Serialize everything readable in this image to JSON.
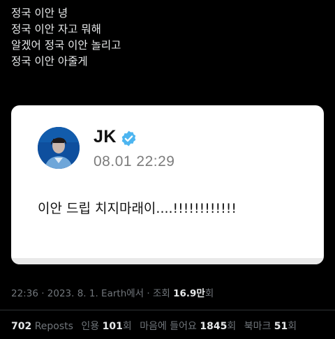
{
  "tweet": {
    "lines": [
      "정국 이안 녕",
      "정국 이안 자고 뭐해",
      "알겠어 정국 이안 놀리고",
      "정국 이안 아줄게"
    ]
  },
  "card": {
    "name": "JK",
    "time": "08.01 22:29",
    "message": "이안 드립 치지마래이....!!!!!!!!!!!!"
  },
  "meta": {
    "timestamp": "22:36 · 2023. 8. 1. Earth에서 · 조회",
    "views_num": "16.9만",
    "views_unit": "회"
  },
  "stats": {
    "reposts_num": "702",
    "reposts_label": "Reposts",
    "quotes_label": "인용",
    "quotes_num": "101",
    "quotes_unit": "회",
    "likes_label": "마음에 들어요",
    "likes_num": "1845",
    "likes_unit": "회",
    "bookmarks_label": "북마크",
    "bookmarks_num": "51",
    "bookmarks_unit": "회"
  },
  "colors": {
    "background": "#000000",
    "verified_badge": "#4db5f0",
    "muted_text": "#71767b"
  },
  "icons": {
    "verified": "verified-badge-icon"
  }
}
